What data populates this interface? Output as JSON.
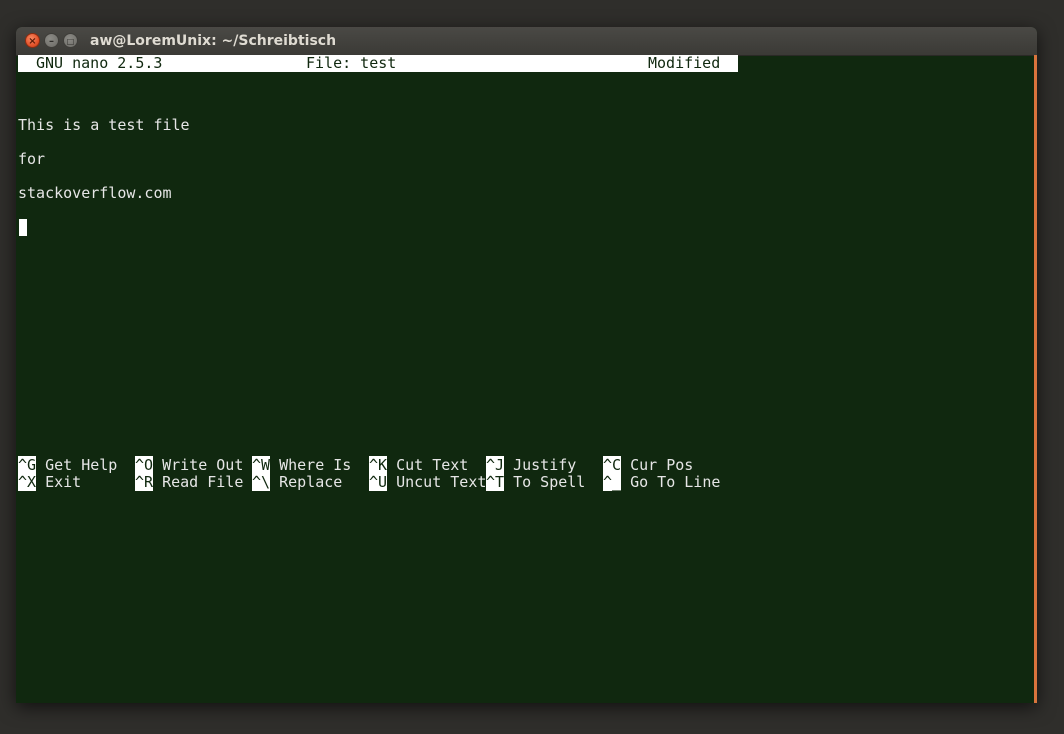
{
  "window": {
    "title": "aw@LoremUnix: ~/Schreibtisch"
  },
  "nano": {
    "version": "GNU nano 2.5.3",
    "file": "File: test",
    "status": "Modified"
  },
  "buffer": {
    "lines": [
      "This is a test file",
      "for",
      "stackoverflow.com"
    ]
  },
  "shortcuts": [
    {
      "key": "^G",
      "label": "Get Help"
    },
    {
      "key": "^O",
      "label": "Write Out"
    },
    {
      "key": "^W",
      "label": "Where Is"
    },
    {
      "key": "^K",
      "label": "Cut Text"
    },
    {
      "key": "^J",
      "label": "Justify"
    },
    {
      "key": "^C",
      "label": "Cur Pos"
    },
    {
      "key": "^X",
      "label": "Exit"
    },
    {
      "key": "^R",
      "label": "Read File"
    },
    {
      "key": "^\\",
      "label": "Replace"
    },
    {
      "key": "^U",
      "label": "Uncut Text"
    },
    {
      "key": "^T",
      "label": "To Spell"
    },
    {
      "key": "^_",
      "label": "Go To Line"
    }
  ],
  "colors": {
    "terminal_bg": "#10280f",
    "terminal_fg": "#e6e6e6",
    "scrollbar": "#d9743d"
  }
}
